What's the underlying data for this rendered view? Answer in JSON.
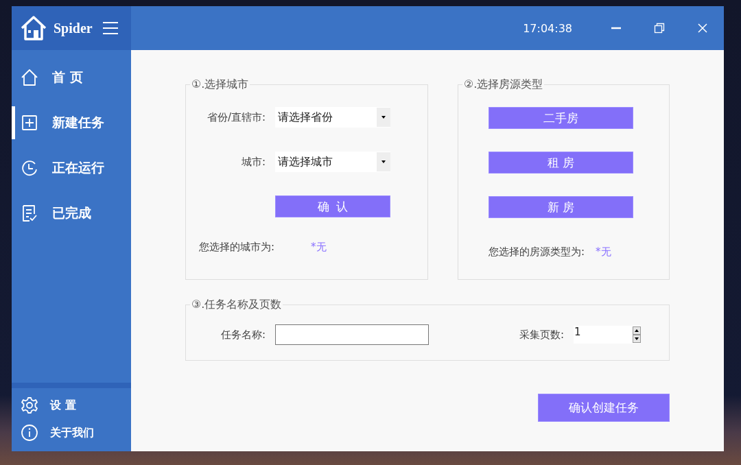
{
  "window": {
    "app_name": "Spider",
    "clock": "17:04:38"
  },
  "sidebar": {
    "items": [
      {
        "label": "首 页",
        "selected": false
      },
      {
        "label": "新建任务",
        "selected": true
      },
      {
        "label": "正在运行",
        "selected": false
      },
      {
        "label": "已完成",
        "selected": false
      }
    ],
    "footer_items": [
      {
        "label": "设 置"
      },
      {
        "label": "关于我们"
      }
    ]
  },
  "city_group": {
    "title": "①.选择城市",
    "fields": [
      {
        "label": "省份/直辖市:",
        "value": "请选择省份"
      },
      {
        "label": "城市:",
        "value": "请选择城市"
      }
    ],
    "confirm_button": "确  认",
    "result_label": "您选择的城市为:",
    "result_value": "*无"
  },
  "house_type_group": {
    "title": "②.选择房源类型",
    "buttons": [
      "二手房",
      "租 房",
      "新 房"
    ],
    "result_label": "您选择的房源类型为:",
    "result_value": "*无"
  },
  "task_group": {
    "title": "③.任务名称及页数",
    "name_label": "任务名称:",
    "pages_label": "采集页数:",
    "pages_value": "1"
  },
  "create_button": "确认创建任务"
}
